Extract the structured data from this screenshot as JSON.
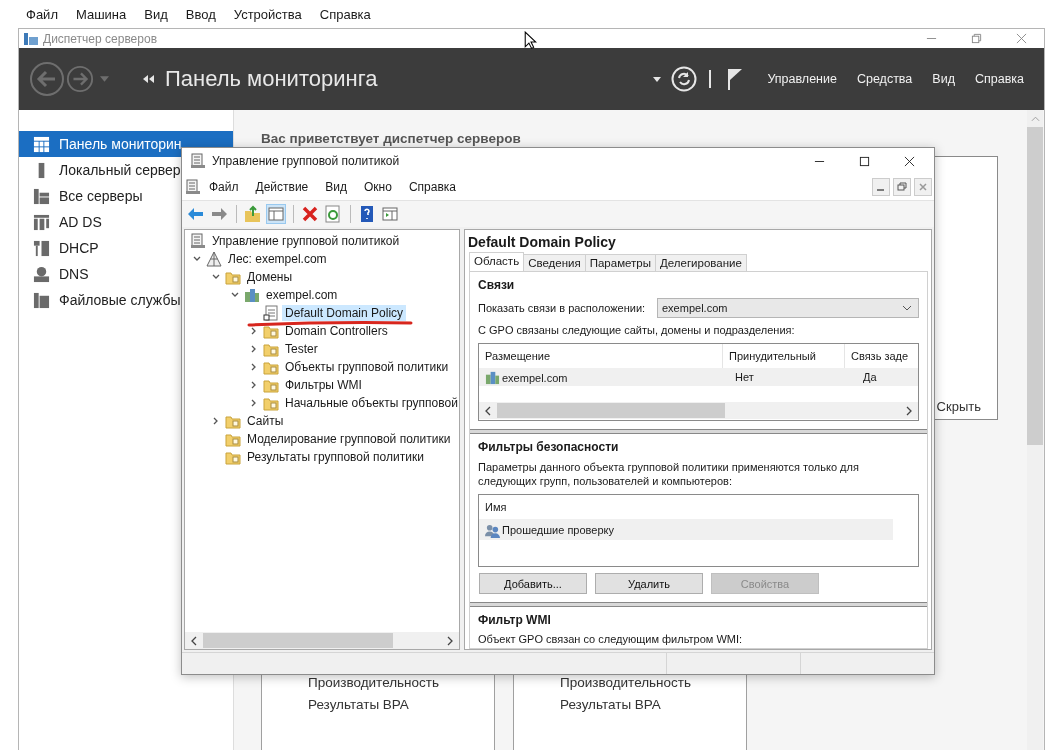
{
  "vm_menu": [
    "Файл",
    "Машина",
    "Вид",
    "Ввод",
    "Устройства",
    "Справка"
  ],
  "server_manager": {
    "title": "Диспетчер серверов",
    "breadcrumb": "Панель мониторинга",
    "header_menu": [
      "Управление",
      "Средства",
      "Вид",
      "Справка"
    ],
    "sidebar": [
      {
        "label": "Панель мониторин",
        "kind": "dashboard",
        "selected": true
      },
      {
        "label": "Локальный сервер",
        "kind": "server",
        "selected": false
      },
      {
        "label": "Все серверы",
        "kind": "servers",
        "selected": false
      },
      {
        "label": "AD DS",
        "kind": "adds",
        "selected": false
      },
      {
        "label": "DHCP",
        "kind": "dhcp",
        "selected": false
      },
      {
        "label": "DNS",
        "kind": "dns",
        "selected": false
      },
      {
        "label": "Файловые службы",
        "kind": "files",
        "selected": false
      }
    ],
    "welcome": "Вас приветствует диспетчер серверов",
    "hide_link": "Скрыть",
    "tiles": [
      {
        "lines": [
          "Производительность",
          "Результаты BPA"
        ]
      },
      {
        "lines": [
          "Производительность",
          "Результаты BPA"
        ]
      }
    ]
  },
  "gpmc": {
    "title": "Управление групповой политикой",
    "menu": [
      "Файл",
      "Действие",
      "Вид",
      "Окно",
      "Справка"
    ],
    "toolbar": [
      {
        "kind": "back",
        "pressed": false
      },
      {
        "kind": "forward",
        "pressed": false
      },
      {
        "kind": "up",
        "pressed": false
      },
      {
        "kind": "tree",
        "pressed": true
      },
      {
        "kind": "delete",
        "pressed": false
      },
      {
        "kind": "refresh",
        "pressed": false
      },
      {
        "kind": "help",
        "pressed": false
      },
      {
        "kind": "pane",
        "pressed": false
      }
    ],
    "tree": {
      "label": "Управление групповой политикой",
      "kind": "console",
      "selected": false,
      "children": [
        {
          "label": "Лес: exempel.com",
          "kind": "forest",
          "expanded": true,
          "selected": false,
          "children": [
            {
              "label": "Домены",
              "kind": "folder",
              "expanded": true,
              "selected": false,
              "children": [
                {
                  "label": "exempel.com",
                  "kind": "domain",
                  "expanded": true,
                  "selected": false,
                  "children": [
                    {
                      "label": "Default Domain Policy",
                      "kind": "gpo",
                      "selected": true
                    },
                    {
                      "label": "Domain Controllers",
                      "kind": "folder",
                      "expanded": false,
                      "selected": false
                    },
                    {
                      "label": "Tester",
                      "kind": "folder",
                      "expanded": false,
                      "selected": false
                    },
                    {
                      "label": "Объекты групповой политики",
                      "kind": "folder",
                      "expanded": false,
                      "selected": false
                    },
                    {
                      "label": "Фильтры WMI",
                      "kind": "folder",
                      "expanded": false,
                      "selected": false
                    },
                    {
                      "label": "Начальные объекты групповой",
                      "kind": "folder",
                      "expanded": false,
                      "selected": false
                    }
                  ]
                }
              ]
            },
            {
              "label": "Сайты",
              "kind": "folder",
              "expanded": false,
              "selected": false
            },
            {
              "label": "Моделирование групповой политики",
              "kind": "folder",
              "selected": false
            },
            {
              "label": "Результаты групповой политики",
              "kind": "folder",
              "selected": false
            }
          ]
        }
      ]
    },
    "details": {
      "title": "Default Domain Policy",
      "tabs": [
        {
          "label": "Область",
          "selected": true
        },
        {
          "label": "Сведения",
          "selected": false
        },
        {
          "label": "Параметры",
          "selected": false
        },
        {
          "label": "Делегирование",
          "selected": false
        }
      ],
      "links": {
        "heading": "Связи",
        "location_label": "Показать связи в расположении:",
        "location_value": "exempel.com",
        "intro": "С GPO связаны следующие сайты, домены и подразделения:",
        "columns": [
          "Размещение",
          "Принудительный",
          "Связь заде"
        ],
        "rows": [
          [
            "exempel.com",
            "Нет",
            "Да"
          ]
        ]
      },
      "security": {
        "heading": "Фильтры безопасности",
        "intro": "Параметры данного объекта групповой политики применяются только для следующих групп, пользователей и компьютеров:",
        "columns": [
          "Имя"
        ],
        "rows": [
          "Прошедшие проверку"
        ],
        "buttons": [
          {
            "label": "Добавить...",
            "disabled": false
          },
          {
            "label": "Удалить",
            "disabled": false
          },
          {
            "label": "Свойства",
            "disabled": true
          }
        ]
      },
      "wmi": {
        "heading": "Фильтр WMI",
        "intro": "Объект GPO связан со следующим фильтром WMI:"
      }
    }
  }
}
